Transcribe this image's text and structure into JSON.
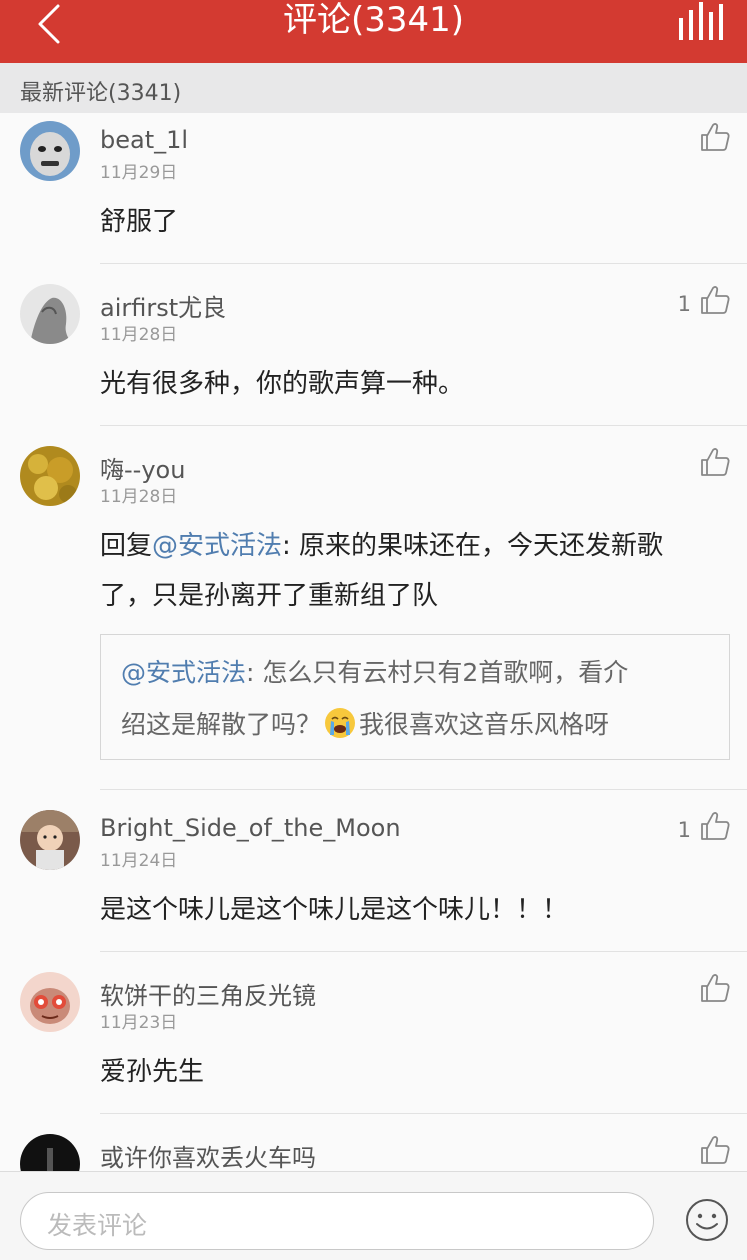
{
  "header": {
    "title": "评论(3341)"
  },
  "section": {
    "label": "最新评论(3341)"
  },
  "comments": [
    {
      "user": "beat_1l",
      "date": "11月29日",
      "likes": "",
      "text": "舒服了"
    },
    {
      "user": "airfirst尤良",
      "date": "11月28日",
      "likes": "1",
      "text": "光有很多种，你的歌声算一种。"
    },
    {
      "user": "嗨--you",
      "date": "11月28日",
      "likes": "",
      "reply_prefix": "回复",
      "reply_to": "@安式活法",
      "text_line1": ": 原来的果味还在，今天还发新歌",
      "text_line2": "了，只是孙离开了重新组了队",
      "quote": {
        "user": "@安式活法",
        "line1": ": 怎么只有云村只有2首歌啊，看介",
        "line2a": "绍这是解散了吗？",
        "line2b": "我很喜欢这音乐风格呀"
      }
    },
    {
      "user": "Bright_Side_of_the_Moon",
      "date": "11月24日",
      "likes": "1",
      "text": "是这个味儿是这个味儿是这个味儿！！！"
    },
    {
      "user": "软饼干的三角反光镜",
      "date": "11月23日",
      "likes": "",
      "text": "爱孙先生"
    },
    {
      "user": "或许你喜欢丢火车吗",
      "date": "",
      "likes": "",
      "text": ""
    }
  ],
  "footer": {
    "placeholder": "发表评论"
  },
  "colors": {
    "accent": "#d33a31",
    "mention": "#507daf"
  },
  "icons": [
    "back-arrow-icon",
    "bar-chart-icon",
    "thumbs-up-icon",
    "crying-emoji-icon",
    "smiley-icon"
  ]
}
